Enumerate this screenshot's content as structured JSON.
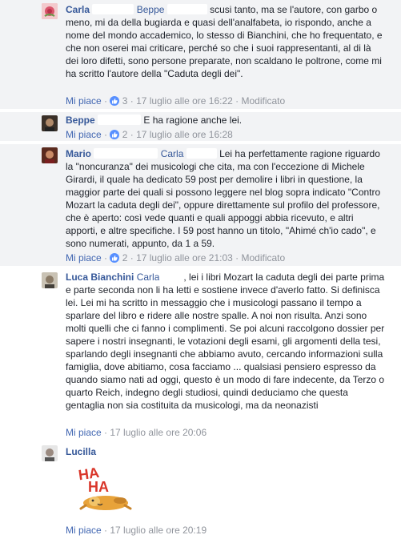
{
  "comments": [
    {
      "author": "Carla",
      "text_a": "scusi tanto, ma se l'autore, con garbo o meno, mi da della bugiarda e quasi dell'analfabeta, io rispondo, anche a nome del mondo accademico, lo stesso di Bianchini, che ho frequentato, e che non oserei mai criticare, perché so che i suoi rappresentanti, al di là dei loro difetti, sono persone preparate, non scaldano le poltrone, come mi ha scritto l'autore della \"Caduta degli dei\".",
      "mention": "Beppe",
      "like_label": "Mi piace",
      "reactions": "3",
      "time": "17 luglio alle ore 16:22",
      "edited": "Modificato"
    },
    {
      "author": "Beppe",
      "text": "E ha ragione anche lei.",
      "like_label": "Mi piace",
      "reactions": "2",
      "time": "17 luglio alle ore 16:28"
    },
    {
      "author": "Mario",
      "mention": "Carla",
      "text": "Lei ha perfettamente ragione riguardo la \"noncuranza\" dei musicologi che cita, ma con l'eccezione di Michele Girardi, il quale ha dedicato 59 post per demolire i libri in questione, la maggior parte dei quali si possono leggere nel blog sopra indicato \"Contro Mozart la caduta degli dei\", oppure direttamente sul profilo del professore, che è aperto: così vede quanti e quali appoggi abbia ricevuto, e altri apporti, e altre specifiche. I 59 post hanno un titolo, \"Ahimé ch'io cado\", e sono numerati, appunto, da 1 a 59.",
      "like_label": "Mi piace",
      "reactions": "2",
      "time": "17 luglio alle ore 21:03",
      "edited": "Modificato"
    },
    {
      "author": "Luca Bianchini",
      "mention_prefix": "Carla",
      "text": ", lei i libri Mozart la caduta degli dei parte prima e parte seconda non li ha letti e sostiene invece d'averlo fatto. Si definisca lei. Lei mi ha scritto in messaggio che i musicologi passano il tempo a sparlare del libro e ridere alle nostre spalle. A noi non risulta. Anzi sono molti quelli che ci fanno i complimenti. Se poi alcuni raccolgono dossier per sapere i nostri insegnanti, le votazioni degli esami, gli argomenti della tesi, sparlando degli insegnanti che abbiamo avuto, cercando informazioni sulla famiglia, dove abitiamo, cosa facciamo ... qualsiasi pensiero espresso da quando siamo nati ad oggi, questo è un modo di fare indecente, da Terzo o quarto Reich, indegno degli studiosi, quindi deduciamo che questa gentaglia non sia costituita da musicologi, ma da neonazisti",
      "like_label": "Mi piace",
      "time": "17 luglio alle ore 20:06"
    },
    {
      "author": "Lucilla",
      "sticker_text": "HA HA",
      "like_label": "Mi piace",
      "time": "17 luglio alle ore 20:19"
    }
  ],
  "colors": {
    "link": "#365899",
    "action": "#4267b2",
    "meta": "#90949c",
    "highlight_bg": "#f2f3f5",
    "like_badge": "#5890ff"
  }
}
